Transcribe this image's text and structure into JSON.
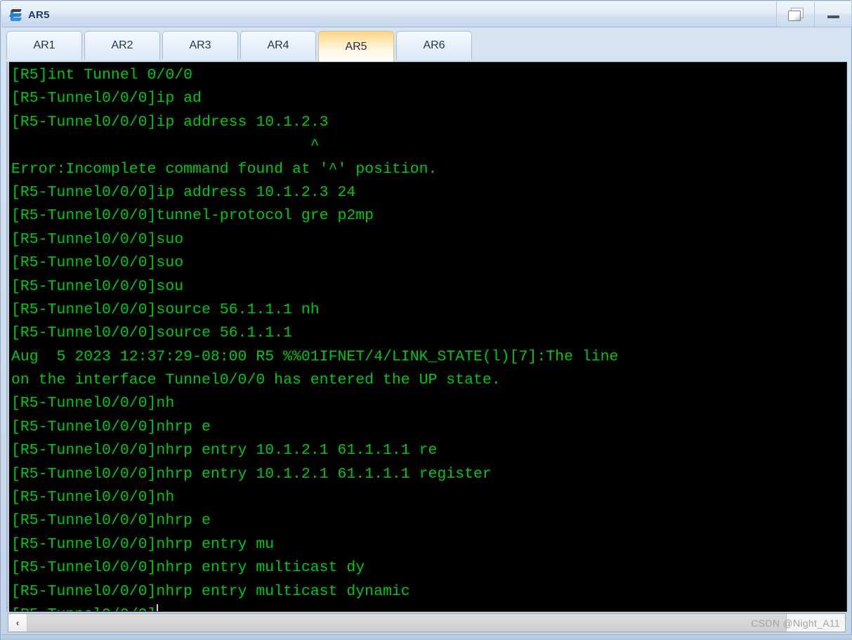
{
  "window": {
    "title": "AR5",
    "icon": "router-icon",
    "buttons": [
      {
        "name": "restore-button",
        "icon": "restore-icon",
        "label": ""
      },
      {
        "name": "minimize-button",
        "icon": "minimize-icon",
        "label": ""
      }
    ]
  },
  "tabs": [
    {
      "label": "AR1",
      "active": false
    },
    {
      "label": "AR2",
      "active": false
    },
    {
      "label": "AR3",
      "active": false
    },
    {
      "label": "AR4",
      "active": false
    },
    {
      "label": "AR5",
      "active": true
    },
    {
      "label": "AR6",
      "active": false
    }
  ],
  "terminal": {
    "foreground": "#00c713",
    "background": "#000000",
    "lines": [
      "[R5]int Tunnel 0/0/0",
      "[R5-Tunnel0/0/0]ip ad",
      "[R5-Tunnel0/0/0]ip address 10.1.2.3",
      "                                 ^",
      "Error:Incomplete command found at '^' position.",
      "[R5-Tunnel0/0/0]ip address 10.1.2.3 24",
      "[R5-Tunnel0/0/0]tunnel-protocol gre p2mp",
      "[R5-Tunnel0/0/0]suo",
      "[R5-Tunnel0/0/0]suo",
      "[R5-Tunnel0/0/0]sou",
      "[R5-Tunnel0/0/0]source 56.1.1.1 nh",
      "[R5-Tunnel0/0/0]source 56.1.1.1",
      "Aug  5 2023 12:37:29-08:00 R5 %%01IFNET/4/LINK_STATE(l)[7]:The line",
      "on the interface Tunnel0/0/0 has entered the UP state.",
      "[R5-Tunnel0/0/0]nh",
      "[R5-Tunnel0/0/0]nhrp e",
      "[R5-Tunnel0/0/0]nhrp entry 10.1.2.1 61.1.1.1 re",
      "[R5-Tunnel0/0/0]nhrp entry 10.1.2.1 61.1.1.1 register",
      "[R5-Tunnel0/0/0]nh",
      "[R5-Tunnel0/0/0]nhrp e",
      "[R5-Tunnel0/0/0]nhrp entry mu",
      "[R5-Tunnel0/0/0]nhrp entry multicast dy",
      "[R5-Tunnel0/0/0]nhrp entry multicast dynamic"
    ],
    "prompt": "[R5-Tunnel0/0/0]"
  },
  "scrollbar": {
    "left_arrow": "‹"
  },
  "watermark": "CSDN @Night_A11"
}
